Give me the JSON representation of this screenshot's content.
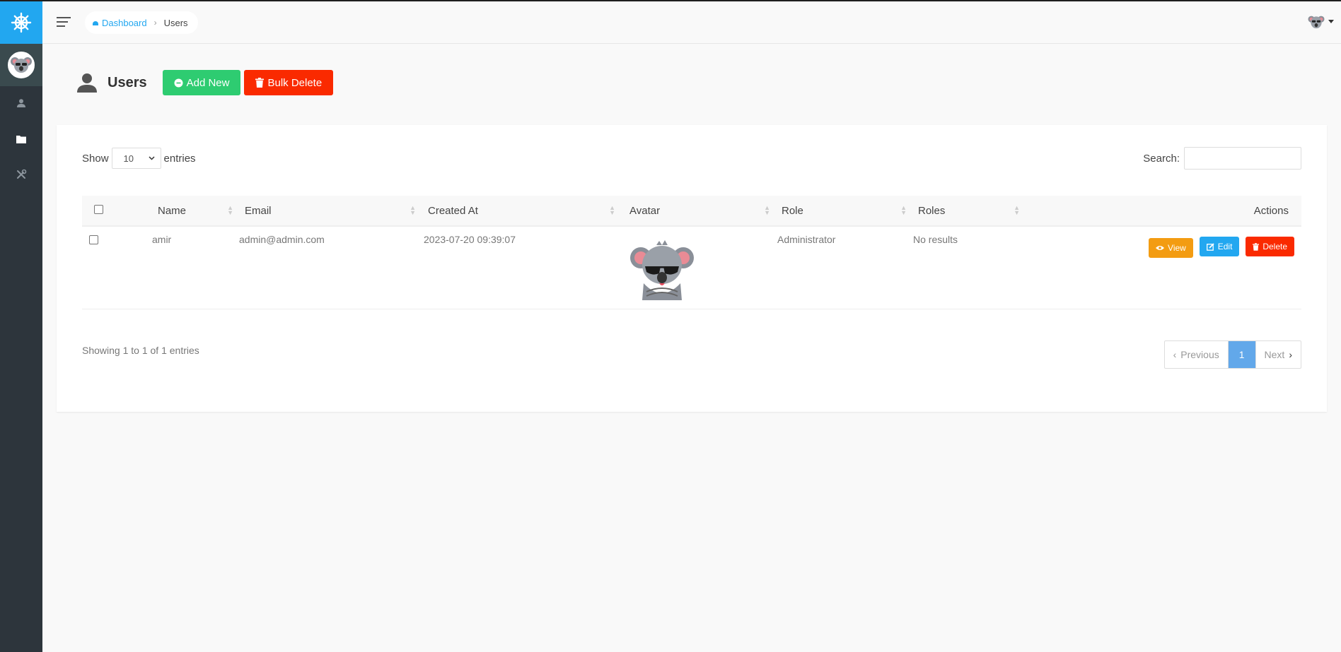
{
  "topbar": {
    "breadcrumb": {
      "home_label": "Dashboard",
      "current_label": "Users"
    }
  },
  "page": {
    "title": "Users",
    "add_new_label": "Add New",
    "bulk_delete_label": "Bulk Delete"
  },
  "datatable": {
    "show_label": "Show",
    "page_length": "10",
    "entries_label": "entries",
    "search_label": "Search:",
    "search_value": "",
    "columns": [
      "Name",
      "Email",
      "Created At",
      "Avatar",
      "Role",
      "Roles",
      "Actions"
    ],
    "rows": [
      {
        "name": "amir",
        "email": "admin@admin.com",
        "created_at": "2023-07-20 09:39:07",
        "role": "Administrator",
        "roles": "No results",
        "actions": {
          "view": "View",
          "edit": "Edit",
          "delete": "Delete"
        }
      }
    ],
    "info": "Showing 1 to 1 of 1 entries",
    "pagination": {
      "previous": "Previous",
      "current_page": "1",
      "next": "Next"
    }
  },
  "colors": {
    "brand": "#22a7f0",
    "sidebar": "#2d353c",
    "success": "#2ecc71",
    "danger": "#fa2a00",
    "warning": "#f39c12",
    "info": "#22a7f0",
    "page_active": "#62a8ea"
  },
  "icons": {
    "brand": "helm-icon",
    "sidebar": [
      "user-icon",
      "folder-icon",
      "tools-icon"
    ],
    "breadcrumb_home": "dashboard-icon",
    "page_title": "user-icon",
    "add_new": "plus-circle-icon",
    "bulk_delete": "trash-icon",
    "view": "eye-icon",
    "edit": "edit-icon",
    "delete": "trash-icon"
  }
}
